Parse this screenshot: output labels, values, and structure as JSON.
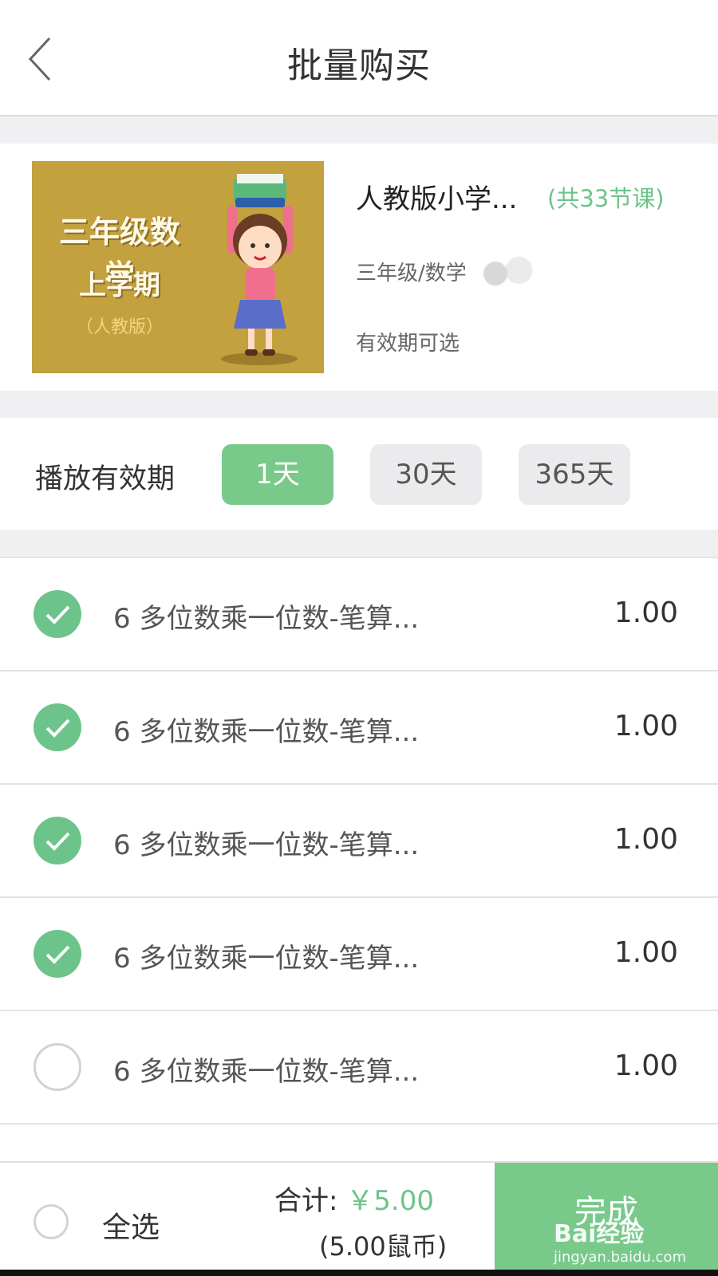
{
  "header": {
    "title": "批量购买",
    "back_icon": "chevron-left-icon"
  },
  "course": {
    "cover": {
      "title": "三年级数学",
      "subtitle": "上学期",
      "edition": "（人教版）"
    },
    "name": "人教版小学...",
    "count": "(共33节课)",
    "meta": "三年级/数学",
    "validity": "有效期可选"
  },
  "period": {
    "label": "播放有效期",
    "options": [
      "1天",
      "30天",
      "365天"
    ],
    "selected": "1天",
    "accent": "#79c98b"
  },
  "lessons": [
    {
      "title": "6 多位数乘一位数-笔算...",
      "price": "1.00",
      "checked": true
    },
    {
      "title": "6 多位数乘一位数-笔算...",
      "price": "1.00",
      "checked": true
    },
    {
      "title": "6 多位数乘一位数-笔算...",
      "price": "1.00",
      "checked": true
    },
    {
      "title": "6 多位数乘一位数-笔算...",
      "price": "1.00",
      "checked": true
    },
    {
      "title": "6 多位数乘一位数-笔算...",
      "price": "1.00",
      "checked": false
    }
  ],
  "footer": {
    "select_all": "全选",
    "total_label": "合计: ",
    "total_amount": "￥5.00",
    "coins": "(5.00鼠币)",
    "done": "完成"
  },
  "watermark": {
    "top": "Bai经验",
    "bottom": "jingyan.baidu.com"
  }
}
